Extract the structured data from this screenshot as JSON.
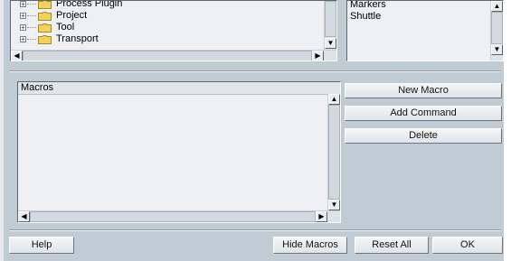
{
  "command_tree": {
    "items": [
      {
        "label": "Process Plugin",
        "icon": "folder-icon"
      },
      {
        "label": "Project",
        "icon": "folder-icon"
      },
      {
        "label": "Tool",
        "icon": "folder-icon"
      },
      {
        "label": "Transport",
        "icon": "folder-icon"
      }
    ]
  },
  "commands_list": {
    "items": [
      "Markers",
      "Shuttle"
    ]
  },
  "macros": {
    "header": "Macros"
  },
  "buttons": {
    "new_macro": "New Macro",
    "add_command": "Add Command",
    "delete": "Delete",
    "help": "Help",
    "hide_macros": "Hide Macros",
    "reset_all": "Reset All",
    "ok": "OK"
  },
  "glyphs": {
    "scroll_up": "▲",
    "scroll_down": "▼",
    "scroll_left": "◀",
    "scroll_right": "▶",
    "expander": "+"
  },
  "colors": {
    "window_bg": "#c1cbd3",
    "panel_bg": "#eef0f4",
    "folder": "#f3d25a"
  }
}
